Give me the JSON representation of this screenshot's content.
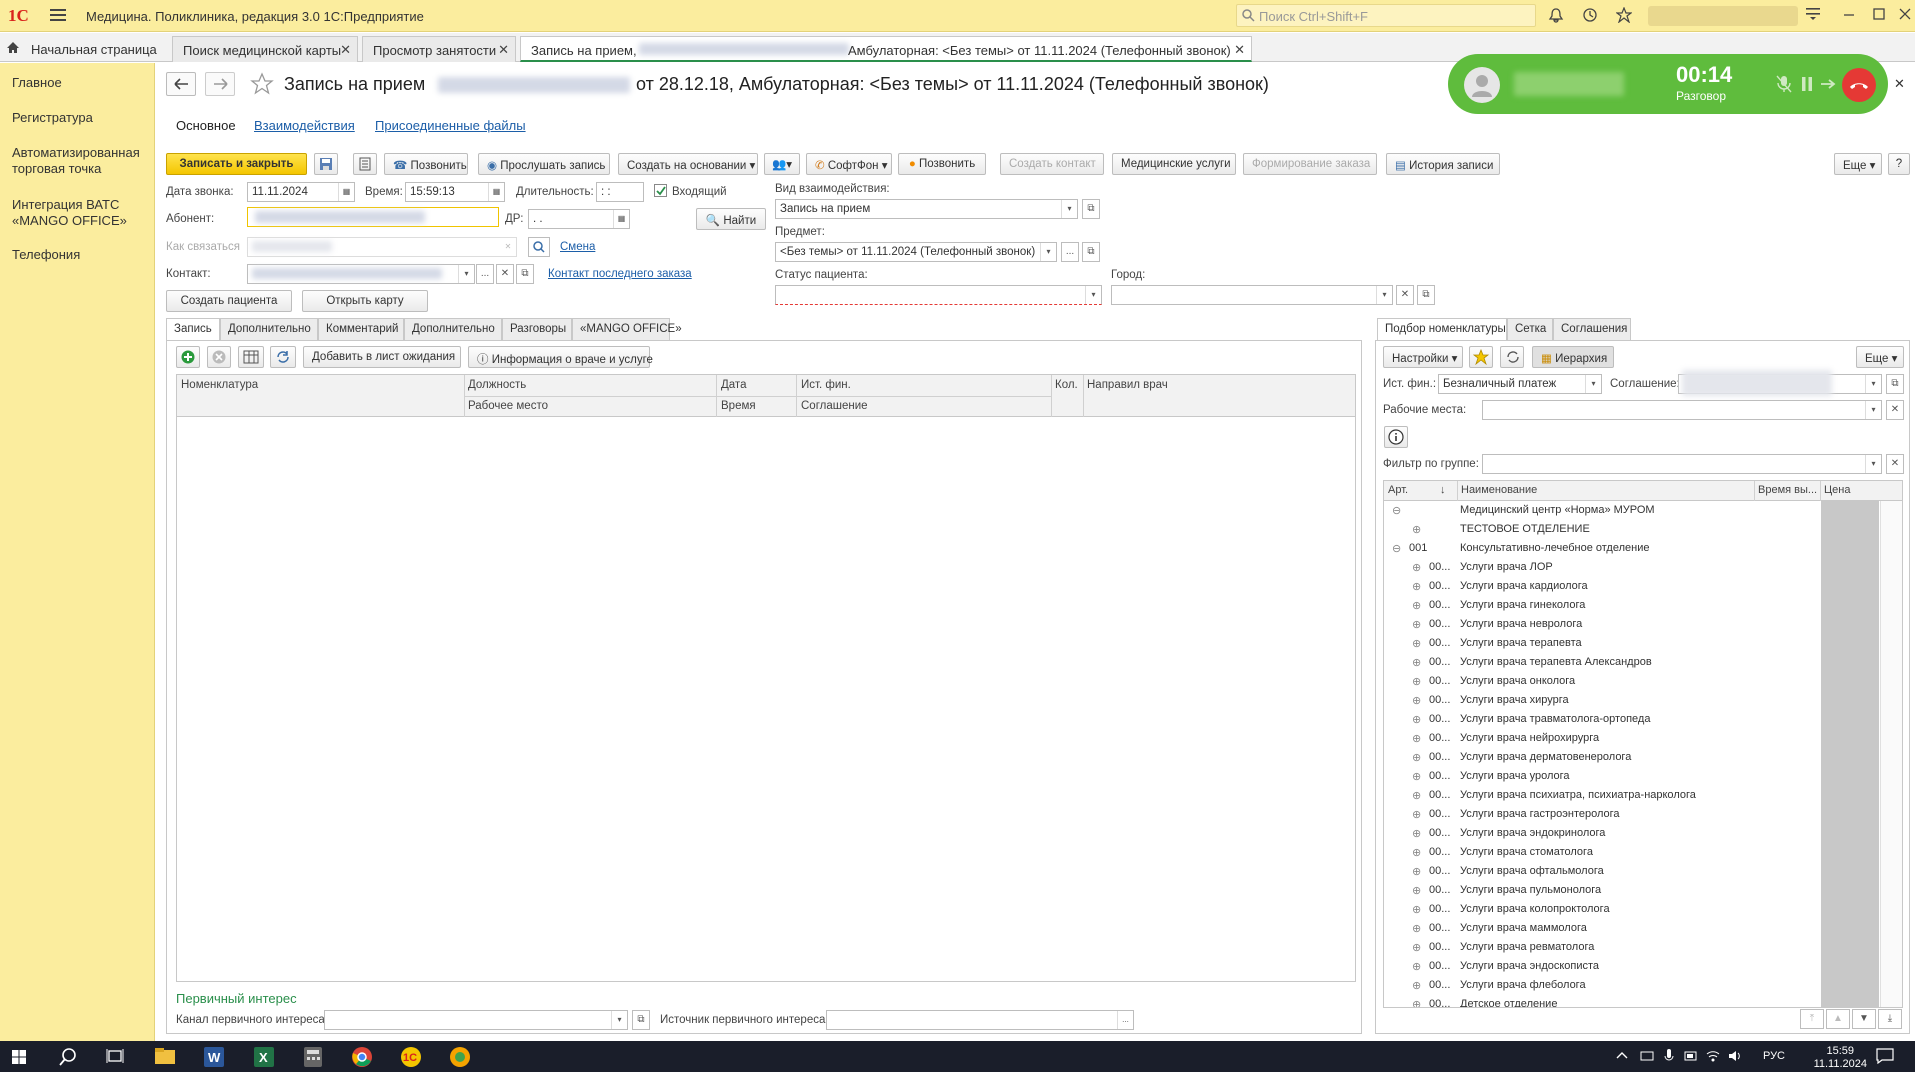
{
  "titlebar": {
    "logo": "1С",
    "title": "Медицина. Поликлиника, редакция 3.0 1С:Предприятие",
    "search_placeholder": "Поиск Ctrl+Shift+F"
  },
  "tabs": [
    {
      "label": "Начальная страница"
    },
    {
      "label": "Поиск медицинской карты"
    },
    {
      "label": "Просмотр занятости"
    },
    {
      "label": "Запись на прием,",
      "suffix": "Амбулаторная: <Без темы> от 11.11.2024 (Телефонный звонок)"
    }
  ],
  "leftnav": {
    "items": [
      "Главное",
      "Регистратура",
      "Автоматизированная торговая точка",
      "Интеграция ВАТС «MANGO OFFICE»",
      "Телефония"
    ]
  },
  "doc": {
    "title_prefix": "Запись на прием",
    "title_suffix": "от 28.12.18, Амбулаторная: <Без темы> от 11.11.2024 (Телефонный звонок)",
    "subnav": [
      "Основное",
      "Взаимодействия",
      "Присоединенные файлы"
    ]
  },
  "toolbar": {
    "save_close": "Записать и закрыть",
    "call": "Позвонить",
    "listen": "Прослушать запись",
    "create_based": "Создать на основании",
    "softphone": "СофтФон",
    "call2": "Позвонить",
    "create_contact": "Создать контакт",
    "med_services": "Медицинские услуги",
    "order_form": "Формирование заказа",
    "history": "История записи",
    "more": "Еще",
    "help": "?"
  },
  "form": {
    "call_date_label": "Дата звонка:",
    "call_date": "11.11.2024",
    "time_label": "Время:",
    "time": "15:59:13",
    "duration_label": "Длительность:",
    "duration": ":  :",
    "incoming_label": "Входящий",
    "subscriber_label": "Абонент:",
    "dr_label": "ДР:",
    "dr": " .  .",
    "find": "Найти",
    "how_contact_label": "Как связаться",
    "change_link": "Смена",
    "contact_label": "Контакт:",
    "last_order_link": "Контакт последнего заказа",
    "create_patient": "Создать пациента",
    "open_card": "Открыть карту",
    "interaction_type_label": "Вид взаимодействия:",
    "interaction_type": "Запись на прием",
    "subject_label": "Предмет:",
    "subject": "<Без темы> от 11.11.2024 (Телефонный звонок)",
    "patient_status_label": "Статус пациента:",
    "city_label": "Город:"
  },
  "lefttabs": [
    "Запись",
    "Дополнительно",
    "Комментарий",
    "Дополнительно",
    "Разговоры",
    "«MANGO OFFICE»"
  ],
  "record_toolbar": {
    "add_waitlist": "Добавить в лист ожидания",
    "doctor_info": "Информация о враче и услуге"
  },
  "record_table": {
    "headers_row1": [
      "Номенклатура",
      "Должность",
      "Дата",
      "Ист. фин.",
      "Кол.",
      "Направил врач"
    ],
    "headers_row2": [
      "Рабочее место",
      "Время",
      "Соглашение"
    ]
  },
  "primary_interest": {
    "title": "Первичный интерес",
    "channel_label": "Канал первичного интереса:",
    "source_label": "Источник первичного интереса:"
  },
  "righttabs": [
    "Подбор номенклатуры",
    "Сетка",
    "Соглашения"
  ],
  "right": {
    "settings": "Настройки",
    "hierarchy": "Иерархия",
    "more": "Еще",
    "fin_label": "Ист. фин.:",
    "fin_value": "Безналичный платеж",
    "agreement_label": "Соглашение:",
    "workplaces_label": "Рабочие места:",
    "group_filter_label": "Фильтр по группе:",
    "headers": [
      "Арт.",
      "Наименование",
      "Время вы...",
      "Цена"
    ]
  },
  "tree": [
    {
      "art": "",
      "name": "Медицинский центр «Норма» МУРОМ",
      "ex": "⊖",
      "lvl": 0
    },
    {
      "art": "",
      "name": "ТЕСТОВОЕ ОТДЕЛЕНИЕ",
      "ex": "⊕",
      "lvl": 1
    },
    {
      "art": "001",
      "name": "Консультативно-лечебное отделение",
      "ex": "⊖",
      "lvl": 0
    },
    {
      "art": "00...",
      "name": "Услуги врача ЛОР",
      "ex": "⊕",
      "lvl": 1
    },
    {
      "art": "00...",
      "name": "Услуги врача кардиолога",
      "ex": "⊕",
      "lvl": 1
    },
    {
      "art": "00...",
      "name": "Услуги врача гинеколога",
      "ex": "⊕",
      "lvl": 1
    },
    {
      "art": "00...",
      "name": "Услуги врача невролога",
      "ex": "⊕",
      "lvl": 1
    },
    {
      "art": "00...",
      "name": "Услуги врача терапевта",
      "ex": "⊕",
      "lvl": 1
    },
    {
      "art": "00...",
      "name": "Услуги врача терапевта Александров",
      "ex": "⊕",
      "lvl": 1
    },
    {
      "art": "00...",
      "name": "Услуги врача онколога",
      "ex": "⊕",
      "lvl": 1
    },
    {
      "art": "00...",
      "name": "Услуги врача хирурга",
      "ex": "⊕",
      "lvl": 1
    },
    {
      "art": "00...",
      "name": "Услуги врача травматолога-ортопеда",
      "ex": "⊕",
      "lvl": 1
    },
    {
      "art": "00...",
      "name": "Услуги врача нейрохирурга",
      "ex": "⊕",
      "lvl": 1
    },
    {
      "art": "00...",
      "name": "Услуги врача дерматовенеролога",
      "ex": "⊕",
      "lvl": 1
    },
    {
      "art": "00...",
      "name": "Услуги врача уролога",
      "ex": "⊕",
      "lvl": 1
    },
    {
      "art": "00...",
      "name": "Услуги врача психиатра, психиатра-нарколога",
      "ex": "⊕",
      "lvl": 1
    },
    {
      "art": "00...",
      "name": "Услуги врача гастроэнтеролога",
      "ex": "⊕",
      "lvl": 1
    },
    {
      "art": "00...",
      "name": "Услуги врача эндокринолога",
      "ex": "⊕",
      "lvl": 1
    },
    {
      "art": "00...",
      "name": "Услуги врача стоматолога",
      "ex": "⊕",
      "lvl": 1
    },
    {
      "art": "00...",
      "name": "Услуги врача офтальмолога",
      "ex": "⊕",
      "lvl": 1
    },
    {
      "art": "00...",
      "name": "Услуги врача пульмонолога",
      "ex": "⊕",
      "lvl": 1
    },
    {
      "art": "00...",
      "name": "Услуги врача колопроктолога",
      "ex": "⊕",
      "lvl": 1
    },
    {
      "art": "00...",
      "name": "Услуги врача маммолога",
      "ex": "⊕",
      "lvl": 1
    },
    {
      "art": "00...",
      "name": "Услуги врача ревматолога",
      "ex": "⊕",
      "lvl": 1
    },
    {
      "art": "00...",
      "name": "Услуги врача эндоскописта",
      "ex": "⊕",
      "lvl": 1
    },
    {
      "art": "00...",
      "name": "Услуги врача флеболога",
      "ex": "⊕",
      "lvl": 1
    },
    {
      "art": "00...",
      "name": "Детское отделение",
      "ex": "⊕",
      "lvl": 1
    }
  ],
  "call": {
    "timer": "00:14",
    "status": "Разговор"
  },
  "taskbar": {
    "lang": "РУС",
    "time": "15:59",
    "date": "11.11.2024"
  },
  "colors": {
    "accent_yellow": "#fbed9e",
    "call_green": "#5fbc3d",
    "hangup_red": "#e53935",
    "link_blue": "#1c5ea8"
  }
}
